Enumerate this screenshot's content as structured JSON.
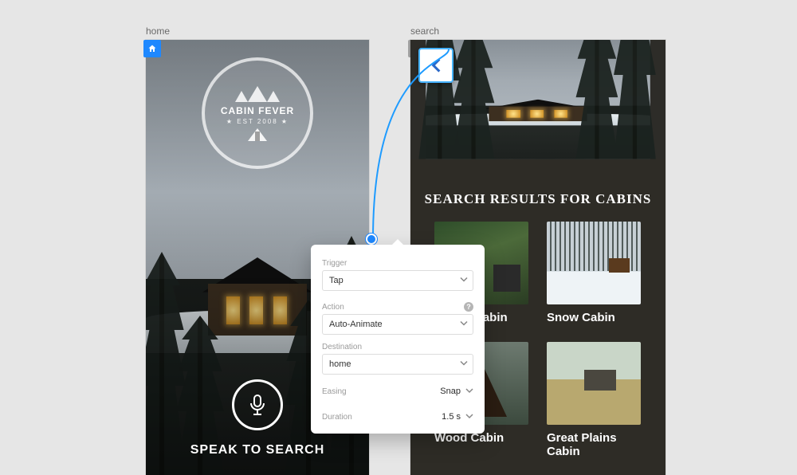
{
  "artboards": {
    "home": {
      "label": "home",
      "logo": {
        "title": "CABIN FEVER",
        "subtitle": "★ EST   2008 ★"
      },
      "cta": "SPEAK TO SEARCH"
    },
    "search": {
      "label": "search",
      "heading": "SEARCH RESULTS FOR CABINS",
      "cards": [
        {
          "name": "Forest Cabin"
        },
        {
          "name": "Snow Cabin"
        },
        {
          "name": "Wood Cabin"
        },
        {
          "name": "Great Plains Cabin"
        }
      ]
    }
  },
  "popover": {
    "trigger": {
      "label": "Trigger",
      "value": "Tap"
    },
    "action": {
      "label": "Action",
      "value": "Auto-Animate"
    },
    "destination": {
      "label": "Destination",
      "value": "home"
    },
    "easing": {
      "label": "Easing",
      "value": "Snap"
    },
    "duration": {
      "label": "Duration",
      "value": "1.5 s"
    }
  }
}
